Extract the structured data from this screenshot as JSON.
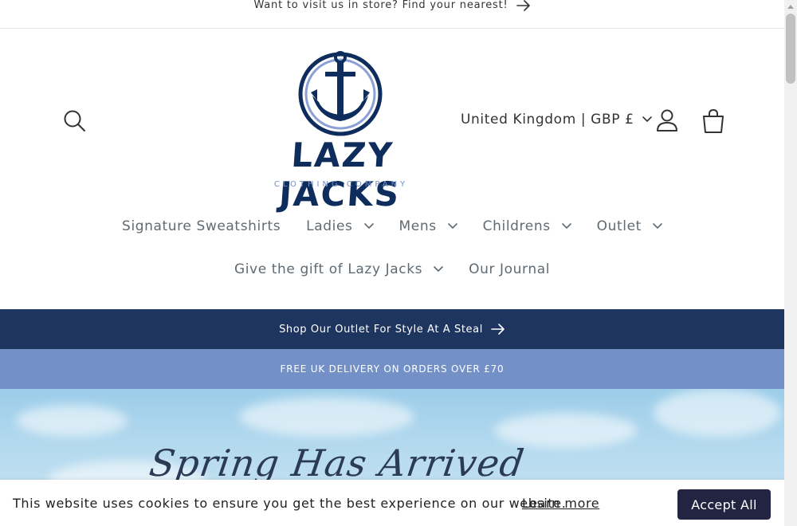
{
  "announcement": {
    "text": "Want to visit us in store? Find your nearest!"
  },
  "header": {
    "logo": {
      "brand": "LAZY JACKS",
      "tagline": "CLOTHING COMPANY"
    },
    "locale_selector": "United Kingdom | GBP £"
  },
  "nav": {
    "row1": [
      {
        "label": "Signature Sweatshirts",
        "has_dropdown": false
      },
      {
        "label": "Ladies",
        "has_dropdown": true
      },
      {
        "label": "Mens",
        "has_dropdown": true
      },
      {
        "label": "Childrens",
        "has_dropdown": true
      },
      {
        "label": "Outlet",
        "has_dropdown": true
      }
    ],
    "row2": [
      {
        "label": "Give the gift of Lazy Jacks",
        "has_dropdown": true
      },
      {
        "label": "Our Journal",
        "has_dropdown": false
      }
    ]
  },
  "banners": {
    "outlet": "Shop Our Outlet For Style At A Steal",
    "delivery": "FREE UK DELIVERY ON ORDERS OVER £70"
  },
  "hero": {
    "title": "Spring Has Arrived"
  },
  "cookie": {
    "text": "This website uses cookies to ensure you get the best experience on our website.",
    "link": "Learn more",
    "accept": "Accept All"
  },
  "colors": {
    "navy": "#1e355f",
    "periwinkle": "#7390c7",
    "logo_blue": "#0f2d5c",
    "logo_light_ring": "#8aa0d6",
    "button_dark": "#232441"
  },
  "icons": [
    "arrow-right-icon",
    "search-icon",
    "chevron-down-icon",
    "account-icon",
    "cart-icon",
    "anchor-icon"
  ]
}
